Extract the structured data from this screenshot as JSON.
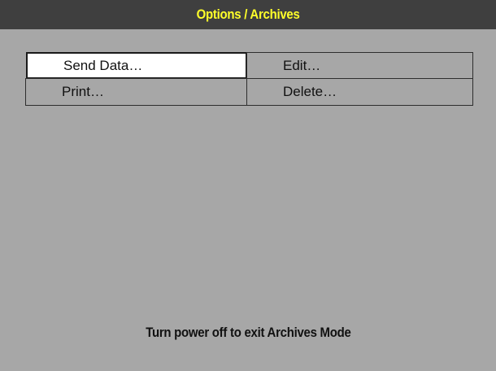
{
  "title_bar": {
    "title": "Options / Archives"
  },
  "menu": {
    "items": [
      {
        "label": "Send Data…",
        "selected": true
      },
      {
        "label": "Edit…",
        "selected": false
      },
      {
        "label": "Print…",
        "selected": false
      },
      {
        "label": "Delete…",
        "selected": false
      }
    ]
  },
  "footer": {
    "message": "Turn power off to exit Archives Mode"
  },
  "colors": {
    "background": "#a7a7a7",
    "title_bar": "#3f3f3f",
    "title_text": "#ffff2a",
    "selected_item": "#ffffff"
  }
}
